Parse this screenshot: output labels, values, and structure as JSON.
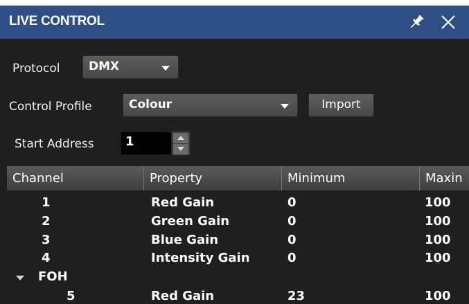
{
  "panel": {
    "title": "LIVE CONTROL"
  },
  "form": {
    "protocol_label": "Protocol",
    "protocol_value": "DMX",
    "profile_label": "Control Profile",
    "profile_value": "Colour",
    "import_label": "Import",
    "start_address_label": "Start Address",
    "start_address_value": "1"
  },
  "table": {
    "columns": [
      "Channel",
      "Property",
      "Minimum",
      "Maxin"
    ],
    "rows": [
      {
        "channel": "1",
        "property": "Red Gain",
        "minimum": "0",
        "maximum": "100"
      },
      {
        "channel": "2",
        "property": "Green Gain",
        "minimum": "0",
        "maximum": "100"
      },
      {
        "channel": "3",
        "property": "Blue Gain",
        "minimum": "0",
        "maximum": "100"
      },
      {
        "channel": "4",
        "property": "Intensity Gain",
        "minimum": "0",
        "maximum": "100"
      }
    ],
    "group": {
      "name": "FOH",
      "rows": [
        {
          "channel": "5",
          "property": "Red Gain",
          "minimum": "23",
          "maximum": "100"
        }
      ]
    }
  },
  "colors": {
    "title_bar": "#2e4f86",
    "background": "#1f1f1f",
    "input_background": "#000000"
  },
  "icons": {
    "pin": "pin-icon",
    "close": "close-icon",
    "group_toggle": "triangle-down-icon"
  }
}
